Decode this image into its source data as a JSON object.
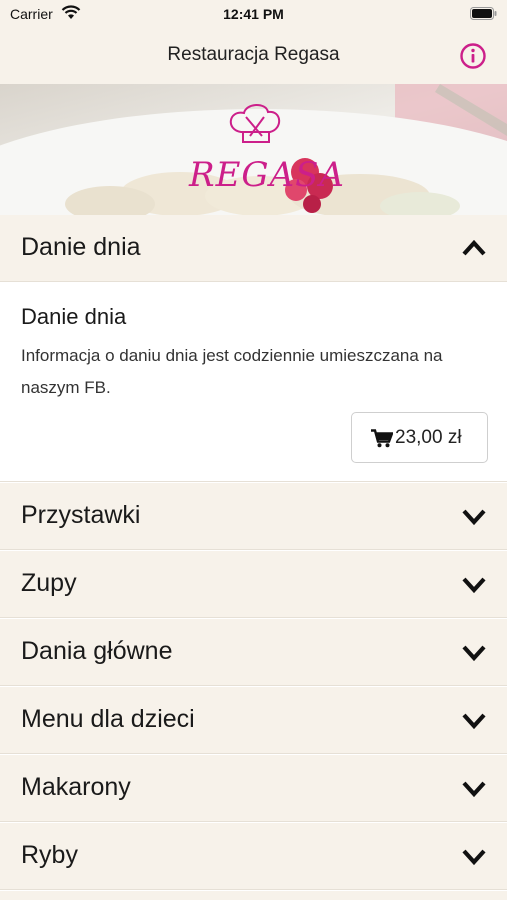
{
  "status_bar": {
    "carrier": "Carrier",
    "time": "12:41 PM"
  },
  "navbar": {
    "title": "Restauracja Regasa"
  },
  "banner": {
    "logo_text": "REGASA"
  },
  "expanded_section": {
    "label": "Danie dnia",
    "dish": {
      "name": "Danie dnia",
      "description": "Informacja o daniu dnia jest codziennie umieszczana na naszym FB.",
      "price": "23,00 zł"
    }
  },
  "sections": [
    {
      "label": "Przystawki"
    },
    {
      "label": "Zupy"
    },
    {
      "label": "Dania główne"
    },
    {
      "label": "Menu dla dzieci"
    },
    {
      "label": "Makarony"
    },
    {
      "label": "Ryby"
    }
  ],
  "colors": {
    "accent": "#cc1f8a",
    "header_bg": "#f7f2ea"
  }
}
